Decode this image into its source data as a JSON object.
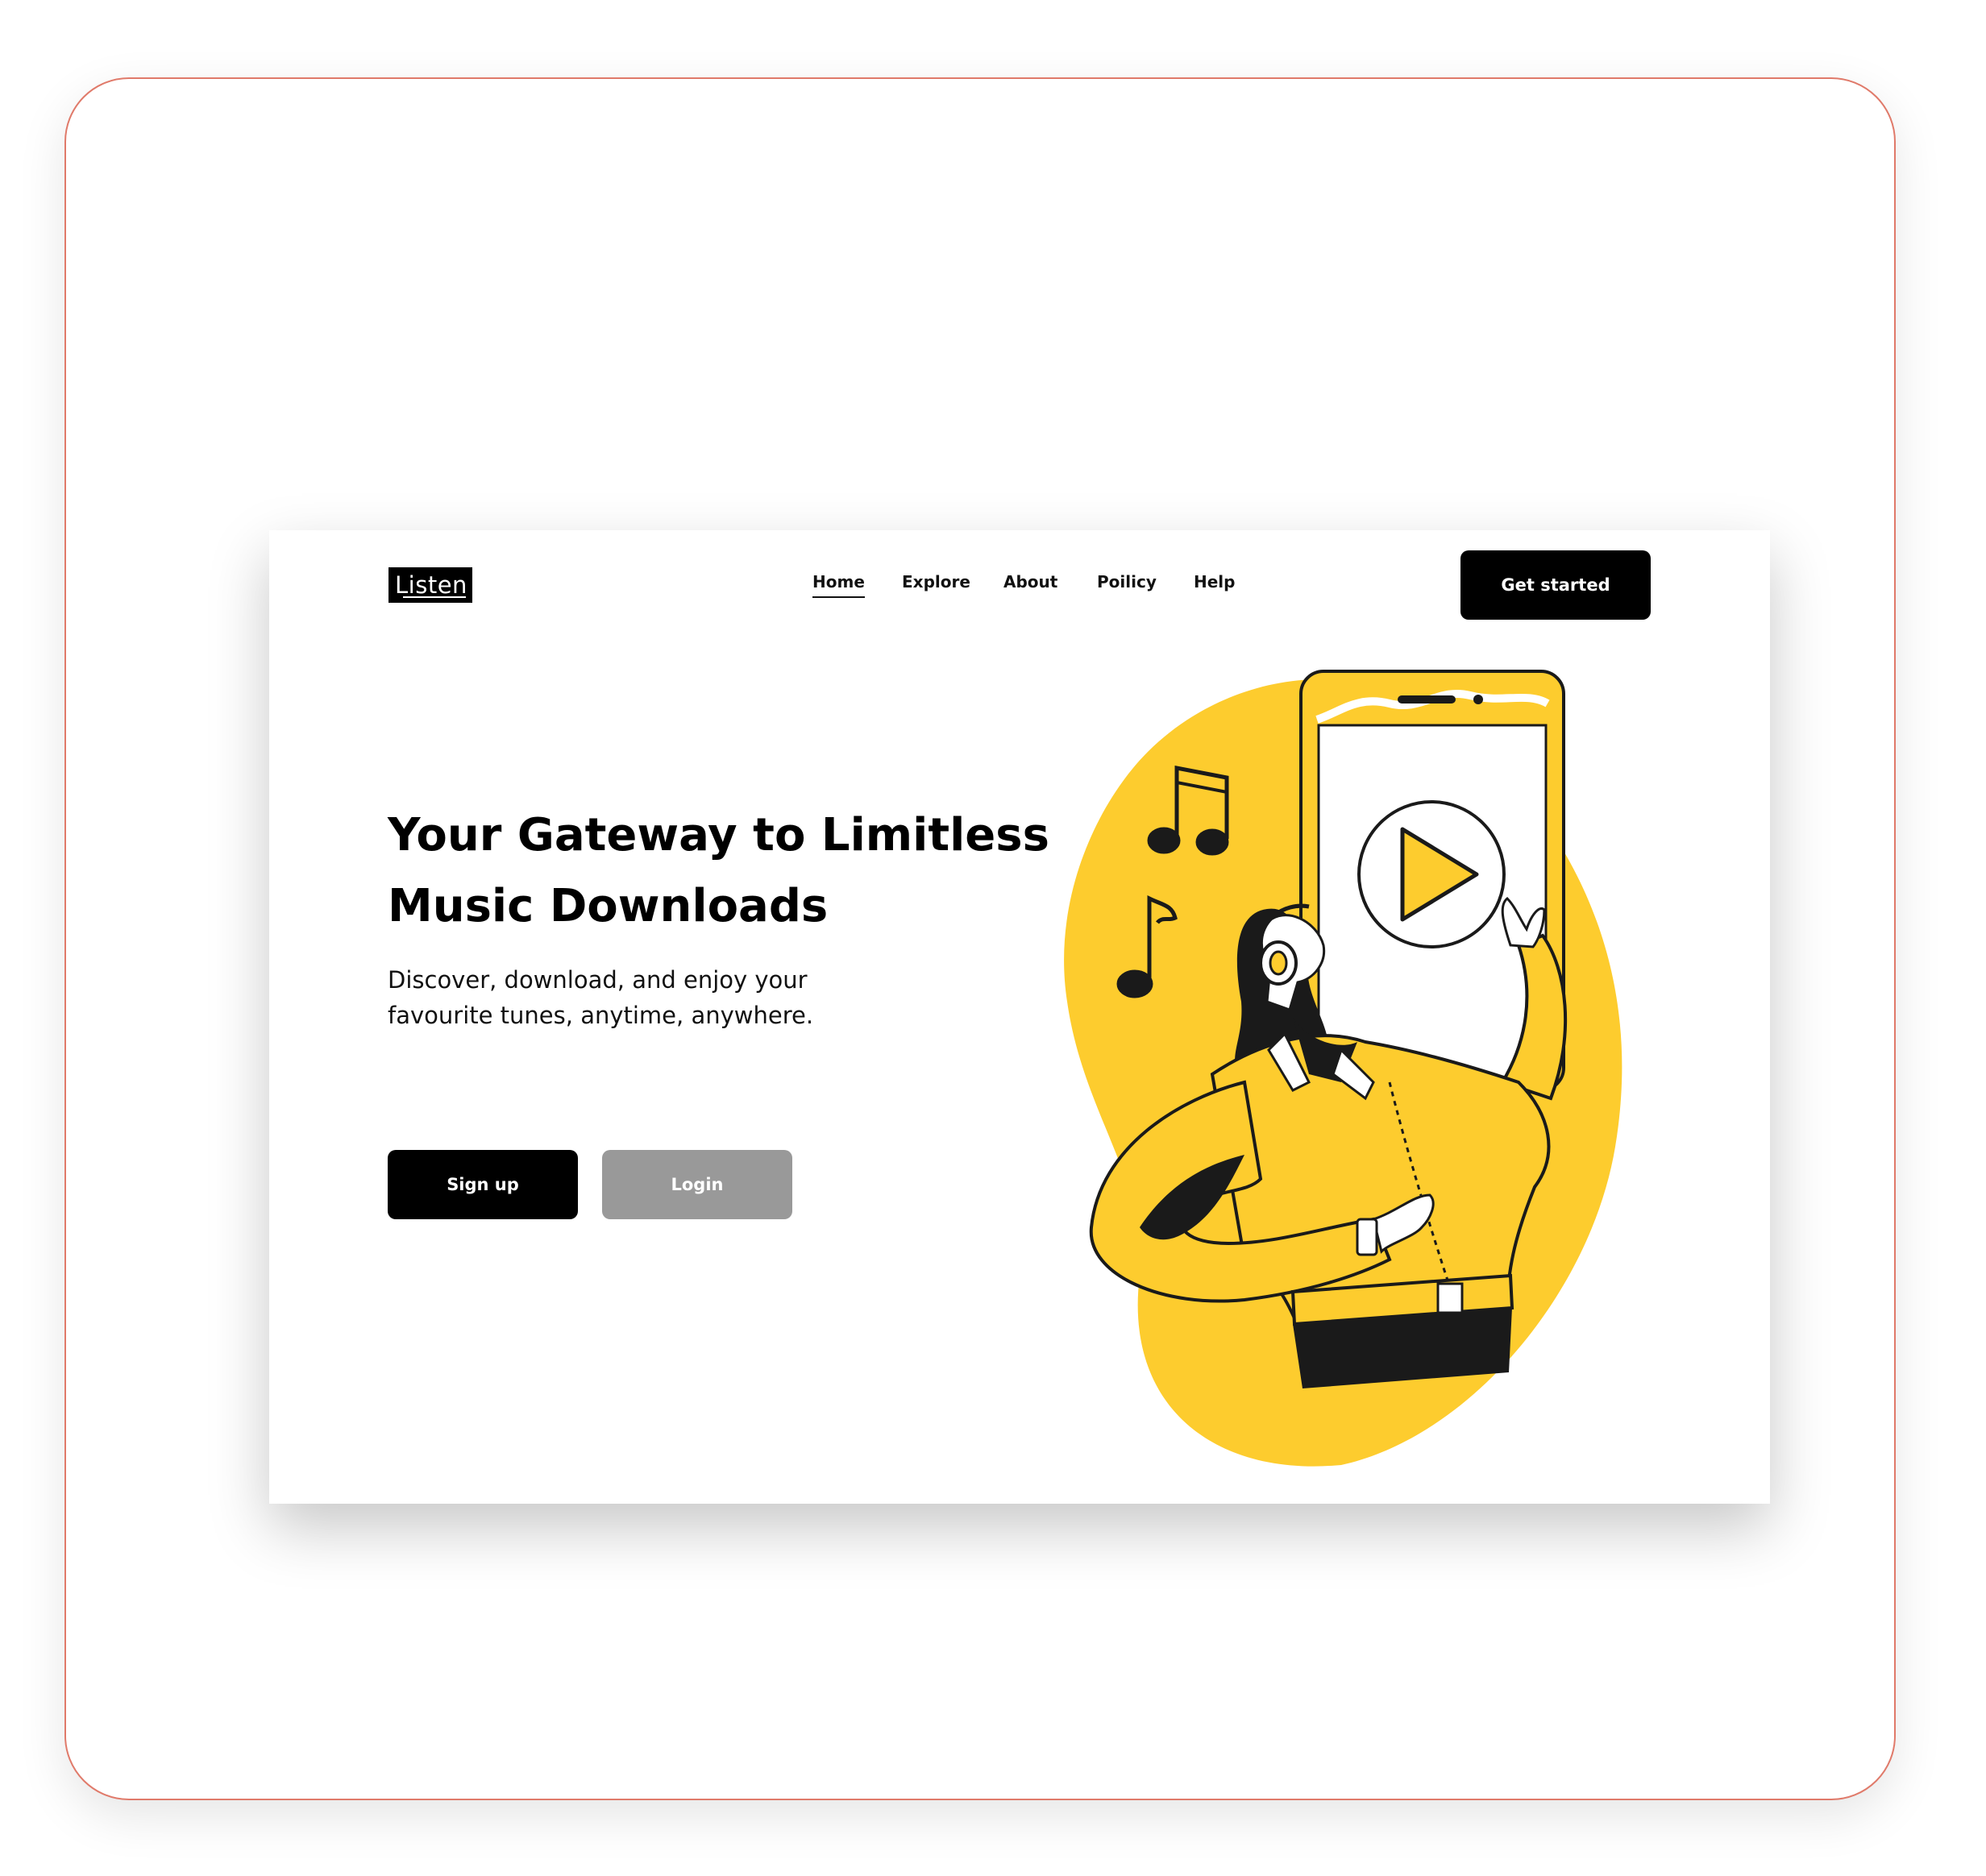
{
  "logo": {
    "text": "Listen"
  },
  "nav": {
    "items": [
      {
        "label": "Home",
        "active": true
      },
      {
        "label": "Explore",
        "active": false
      },
      {
        "label": "About",
        "active": false
      },
      {
        "label": "Poilicy",
        "active": false
      },
      {
        "label": "Help",
        "active": false
      }
    ]
  },
  "header": {
    "cta_label": "Get started"
  },
  "hero": {
    "title": "Your Gateway to Limitless Music Downloads",
    "subtitle": "Discover, download, and enjoy your favourite tunes, anytime, anywhere.",
    "signup_label": "Sign up",
    "login_label": "Login"
  },
  "colors": {
    "accent_yellow": "#FDCC2E",
    "primary_black": "#000000",
    "secondary_gray": "#999999",
    "frame_border": "#E07A6A"
  },
  "illustration": {
    "icons": [
      "music-note-icon",
      "play-icon",
      "phone-icon",
      "headphones-icon"
    ]
  }
}
